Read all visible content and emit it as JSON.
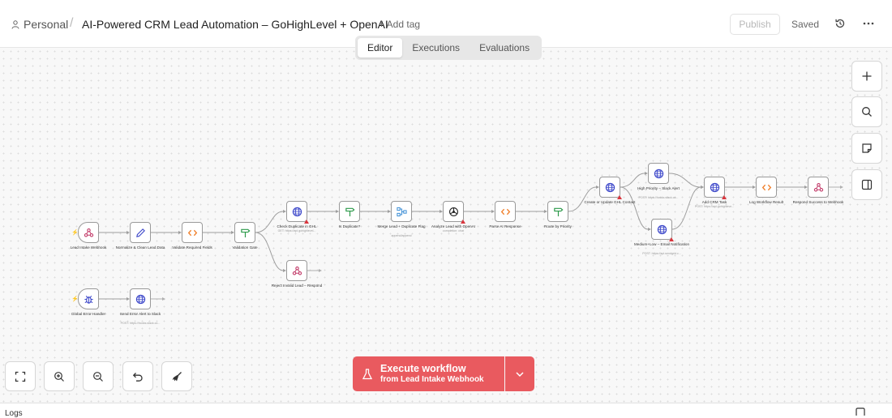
{
  "header": {
    "project": "Personal",
    "separator": "/",
    "title": "AI-Powered CRM Lead Automation – GoHighLevel + OpenAI",
    "add_tag": "+ Add tag",
    "publish_label": "Publish",
    "saved_label": "Saved"
  },
  "tabs": [
    {
      "label": "Editor",
      "active": true
    },
    {
      "label": "Executions",
      "active": false
    },
    {
      "label": "Evaluations",
      "active": false
    }
  ],
  "nodes": [
    {
      "id": "lead-intake-webhook",
      "label": "Lead Intake Webhook",
      "icon": "webhook-icon",
      "trigger": true,
      "sub": "",
      "warn": false
    },
    {
      "id": "normalize-clean",
      "label": "Normalize & Clean Lead Data",
      "icon": "pencil-icon",
      "sub": "",
      "warn": false
    },
    {
      "id": "validate-required",
      "label": "Validate Required Fields",
      "icon": "code-icon",
      "sub": "",
      "warn": false
    },
    {
      "id": "validation-gate",
      "label": "Validation Gate",
      "icon": "signpost-icon",
      "sub": "",
      "warn": false
    },
    {
      "id": "check-duplicate",
      "label": "Check Duplicate in GHL",
      "icon": "globe-icon",
      "sub": "GET: https://api.gohighlevel...",
      "warn": true
    },
    {
      "id": "is-duplicate",
      "label": "Is Duplicate?",
      "icon": "signpost-icon",
      "sub": "",
      "warn": false
    },
    {
      "id": "merge-lead",
      "label": "Merge Lead + Duplicate Flag",
      "icon": "merge-icon",
      "sub": "append/append",
      "warn": false
    },
    {
      "id": "analyze-lead",
      "label": "Analyze Lead with OpenAI",
      "icon": "openai-icon",
      "sub": "completion: chat",
      "warn": true
    },
    {
      "id": "parse-ai",
      "label": "Parse AI Response",
      "icon": "code-icon",
      "sub": "",
      "warn": false
    },
    {
      "id": "route-priority",
      "label": "Route by Priority",
      "icon": "signpost-icon",
      "sub": "",
      "warn": false
    },
    {
      "id": "create-update-ghl",
      "label": "Create or Update GHL Contact",
      "icon": "globe-icon",
      "sub": "",
      "warn": true
    },
    {
      "id": "high-priority-slack",
      "label": "High Priority – Slack Alert",
      "icon": "globe-icon",
      "sub": "POST: https://hooks.slack.co...",
      "warn": false
    },
    {
      "id": "medium-low-email",
      "label": "Medium+Low – Email Notification",
      "icon": "globe-icon",
      "sub": "POST: https://api.sendgrid.c...",
      "warn": true
    },
    {
      "id": "add-crm-task",
      "label": "Add CRM Task",
      "icon": "globe-icon",
      "sub": "POST: https://api.gohighleve...",
      "warn": true
    },
    {
      "id": "log-workflow",
      "label": "Log Workflow Result",
      "icon": "code-icon",
      "sub": "",
      "warn": false
    },
    {
      "id": "respond-success",
      "label": "Respond Success to Webhook",
      "icon": "webhook-icon",
      "sub": "",
      "warn": false
    },
    {
      "id": "reject-invalid",
      "label": "Reject Invalid Lead – Respond",
      "icon": "webhook-icon",
      "sub": "",
      "warn": false
    },
    {
      "id": "global-error",
      "label": "Global Error Handler",
      "icon": "bug-icon",
      "trigger": true,
      "sub": "",
      "warn": false
    },
    {
      "id": "send-error-slack",
      "label": "Send Error Alert to Slack",
      "icon": "globe-icon",
      "sub": "POST: https://hooks.slack.co...",
      "warn": false
    }
  ],
  "execute": {
    "main": "Execute workflow",
    "sub": "from Lead Intake Webhook",
    "color": "#e95a5f"
  },
  "footer": {
    "logs_label": "Logs"
  }
}
